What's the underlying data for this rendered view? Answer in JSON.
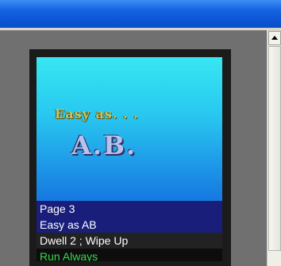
{
  "slide": {
    "line1": "Easy as. . .",
    "line2": "A.B."
  },
  "info": {
    "page": "Page 3",
    "name": "Easy as AB",
    "dwell": "Dwell 2 ; Wipe Up",
    "run": "Run Always"
  },
  "icons": {
    "scroll_up": "arrow-up-icon"
  },
  "colors": {
    "titlebar": "#1764e3",
    "slide_top": "#37e6f2",
    "slide_bottom": "#1678e0",
    "info_highlight": "#181e7a",
    "run_text": "#36d94a"
  }
}
